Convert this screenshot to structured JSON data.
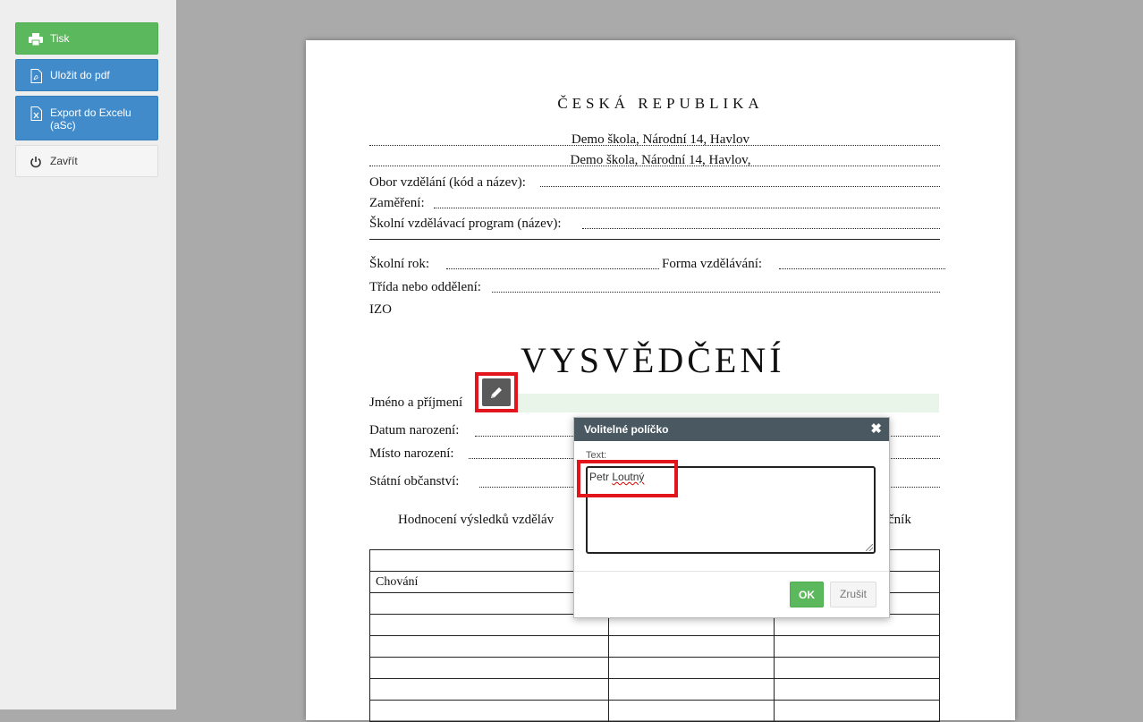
{
  "sidebar": {
    "print_label": "Tisk",
    "pdf_label": "Uložit do pdf",
    "excel_label_line1": "Export do Excelu",
    "excel_label_line2": "(aSc)",
    "close_label": "Zavřít"
  },
  "document": {
    "country": "ČESKÁ REPUBLIKA",
    "school_line1": "Demo škola, Národní 14, Havlov",
    "school_line2": "Demo škola, Národní 14, Havlov,",
    "field_obor": "Obor vzdělání (kód a název):",
    "field_zamereni": "Zaměření:",
    "field_program": "Školní vzdělávací program (název):",
    "field_rok": "Školní rok:",
    "field_forma": "Forma vzdělávání:",
    "field_trida": "Třída nebo oddělení:",
    "field_izo": "IZO",
    "title": "VYSVĚDČENÍ",
    "field_jmeno": "Jméno a příjmení",
    "field_datum": "Datum narození:",
    "field_misto": "Místo narození:",
    "field_obcanstvi": "Státní občanství:",
    "hodnoceni_left": "Hodnocení výsledků vzděláv",
    "hodnoceni_right": "čník",
    "table_chovani": "Chování"
  },
  "dialog": {
    "title": "Volitelné políčko",
    "close_glyph": "✖",
    "text_label": "Text:",
    "text_value_first": "Petr",
    "text_value_second": "Loutný",
    "ok_label": "OK",
    "cancel_label": "Zrušit"
  },
  "colors": {
    "print_button": "#5cb85c",
    "primary_button": "#428bca",
    "highlight": "#e3151c",
    "dialog_header": "#4a5961"
  }
}
